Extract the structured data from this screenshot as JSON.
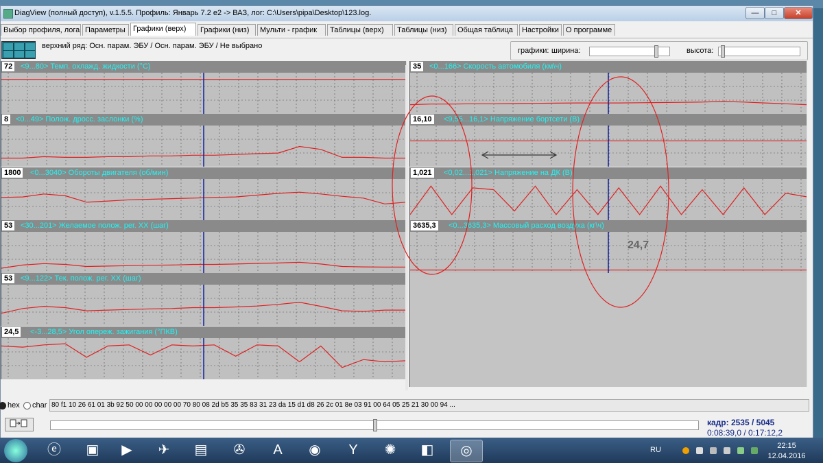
{
  "window": {
    "title": "DiagView (полный доступ), v.1.5.5. Профиль: Январь 7.2 e2 -> ВАЗ,    лог: C:\\Users\\pipa\\Desktop\\123.log.",
    "min": "—",
    "max": "□",
    "close": "✕"
  },
  "tabs": [
    "Выбор профиля, лога",
    "Параметры",
    "Графики (верх)",
    "Графики (низ)",
    "Мульти - график",
    "Таблицы (верх)",
    "Таблицы (низ)",
    "Общая таблица",
    "Настройки",
    "О программе"
  ],
  "active_tab": 2,
  "info": {
    "rows": "верхний ряд: Осн. парам. ЭБУ / Осн. парам. ЭБУ / Не выбрано",
    "graphs_label": "графики:",
    "width_label": "ширина:",
    "height_label": "высота:",
    "width_value": 0.84,
    "height_value": 0.03
  },
  "panels_left": [
    {
      "value": "72",
      "title": "<9...80> Темп. охлажд. жидкости (°C)",
      "min": 9,
      "max": 80,
      "series": [
        72,
        72,
        72,
        72,
        72,
        72,
        72,
        72,
        72,
        72,
        72,
        72,
        72,
        72,
        72,
        72,
        72,
        72,
        72,
        72
      ]
    },
    {
      "value": "8",
      "title": "<0...49> Полож. дросс. заслонки (%)",
      "min": 0,
      "max": 49,
      "series": [
        8,
        8,
        10,
        9,
        9,
        10,
        10,
        11,
        11,
        12,
        12,
        13,
        14,
        15,
        24,
        20,
        9,
        9,
        8,
        8
      ]
    },
    {
      "value": "1800",
      "title": "<0...3040> Обороты двигателя (об/мин)",
      "min": 0,
      "max": 3040,
      "series": [
        1700,
        1750,
        2000,
        1850,
        1300,
        1400,
        1500,
        1550,
        1600,
        1650,
        1700,
        1750,
        1900,
        2050,
        2150,
        2000,
        1800,
        1650,
        1150,
        1300
      ]
    },
    {
      "value": "53",
      "title": "<30...201> Желаемое полож. рег. ХХ (шаг)",
      "min": 30,
      "max": 201,
      "series": [
        40,
        55,
        62,
        58,
        48,
        50,
        52,
        54,
        55,
        58,
        58,
        60,
        63,
        65,
        68,
        60,
        48,
        46,
        45,
        45
      ]
    },
    {
      "value": "53",
      "title": "<9...122> Тек. полож. рег. ХХ (шаг)",
      "min": 9,
      "max": 122,
      "series": [
        40,
        55,
        62,
        58,
        48,
        50,
        52,
        54,
        55,
        58,
        58,
        60,
        63,
        68,
        75,
        62,
        48,
        46,
        50,
        50
      ]
    },
    {
      "value": "24,5",
      "title": "<-3...28,5> Угол опереж. зажигания (°ПКВ)",
      "min": -3,
      "max": 28.5,
      "series": [
        24,
        23,
        25,
        26,
        14,
        24,
        25,
        16,
        25,
        24,
        25,
        15,
        25,
        24,
        10,
        24,
        5,
        12,
        10,
        11
      ]
    }
  ],
  "panels_right": [
    {
      "value": "35",
      "title": "<0...166> Скорость автомобиля (км\\ч)",
      "min": 0,
      "max": 166,
      "series": [
        30,
        33,
        33,
        34,
        34,
        35,
        36,
        37,
        38,
        38,
        38,
        39,
        40,
        41,
        42,
        45,
        42,
        38,
        34,
        30
      ]
    },
    {
      "value": "16,10",
      "title": "<9,55...16,1> Напряжение бортсети (В)",
      "min": 9.55,
      "max": 16.1,
      "series": [
        13.8,
        13.8,
        13.8,
        13.8,
        13.8,
        13.8,
        13.8,
        13.8,
        13.8,
        13.8,
        13.8,
        13.8,
        13.8,
        13.8,
        13.8,
        13.8,
        13.8,
        13.8,
        13.8,
        13.8
      ]
    },
    {
      "value": "1,021",
      "title": "<0,02...1,021> Напряжение на ДК (В)",
      "min": 0.02,
      "max": 1.021,
      "series": [
        0.1,
        0.9,
        0.1,
        0.85,
        0.8,
        0.2,
        0.9,
        0.1,
        0.8,
        0.1,
        0.85,
        0.1,
        0.9,
        0.1,
        0.8,
        0.1,
        0.85,
        0.1,
        0.7,
        0.6
      ]
    },
    {
      "value": "3635,3",
      "title": "<0...3635,3> Массовый расход воздуха (кг\\ч)",
      "min": 0,
      "max": 3635.3,
      "series": [
        20,
        20,
        20,
        20,
        20,
        20,
        20,
        20,
        20,
        20,
        20,
        20,
        20,
        20,
        20,
        20,
        20,
        20,
        20,
        20
      ]
    }
  ],
  "annotation_value": "24,7",
  "cursor_fraction": 0.5,
  "hex": {
    "hex_label": "hex",
    "char_label": "char",
    "bytes": "80 f1 10 26 61 01 3b 92 50 00 00 00 00 00 70 80 08 2d b5 35 35 83 31 23 da 15 d1 d8 26 2c 01 8e 03 91 00 64 05 25 21 30 00 94 ..."
  },
  "status": {
    "frame": "кадр: 2535 / 5045",
    "time": "0:08:39,0 / 0:17:12,2",
    "position": 0.5025
  },
  "taskbar": {
    "lang": "RU",
    "time": "22:15",
    "date": "12.04.2016"
  },
  "colors": {
    "trace": "#e02020",
    "cursor": "#1020a0",
    "panel_title": "#1ef6f6",
    "grid": "#505050"
  }
}
